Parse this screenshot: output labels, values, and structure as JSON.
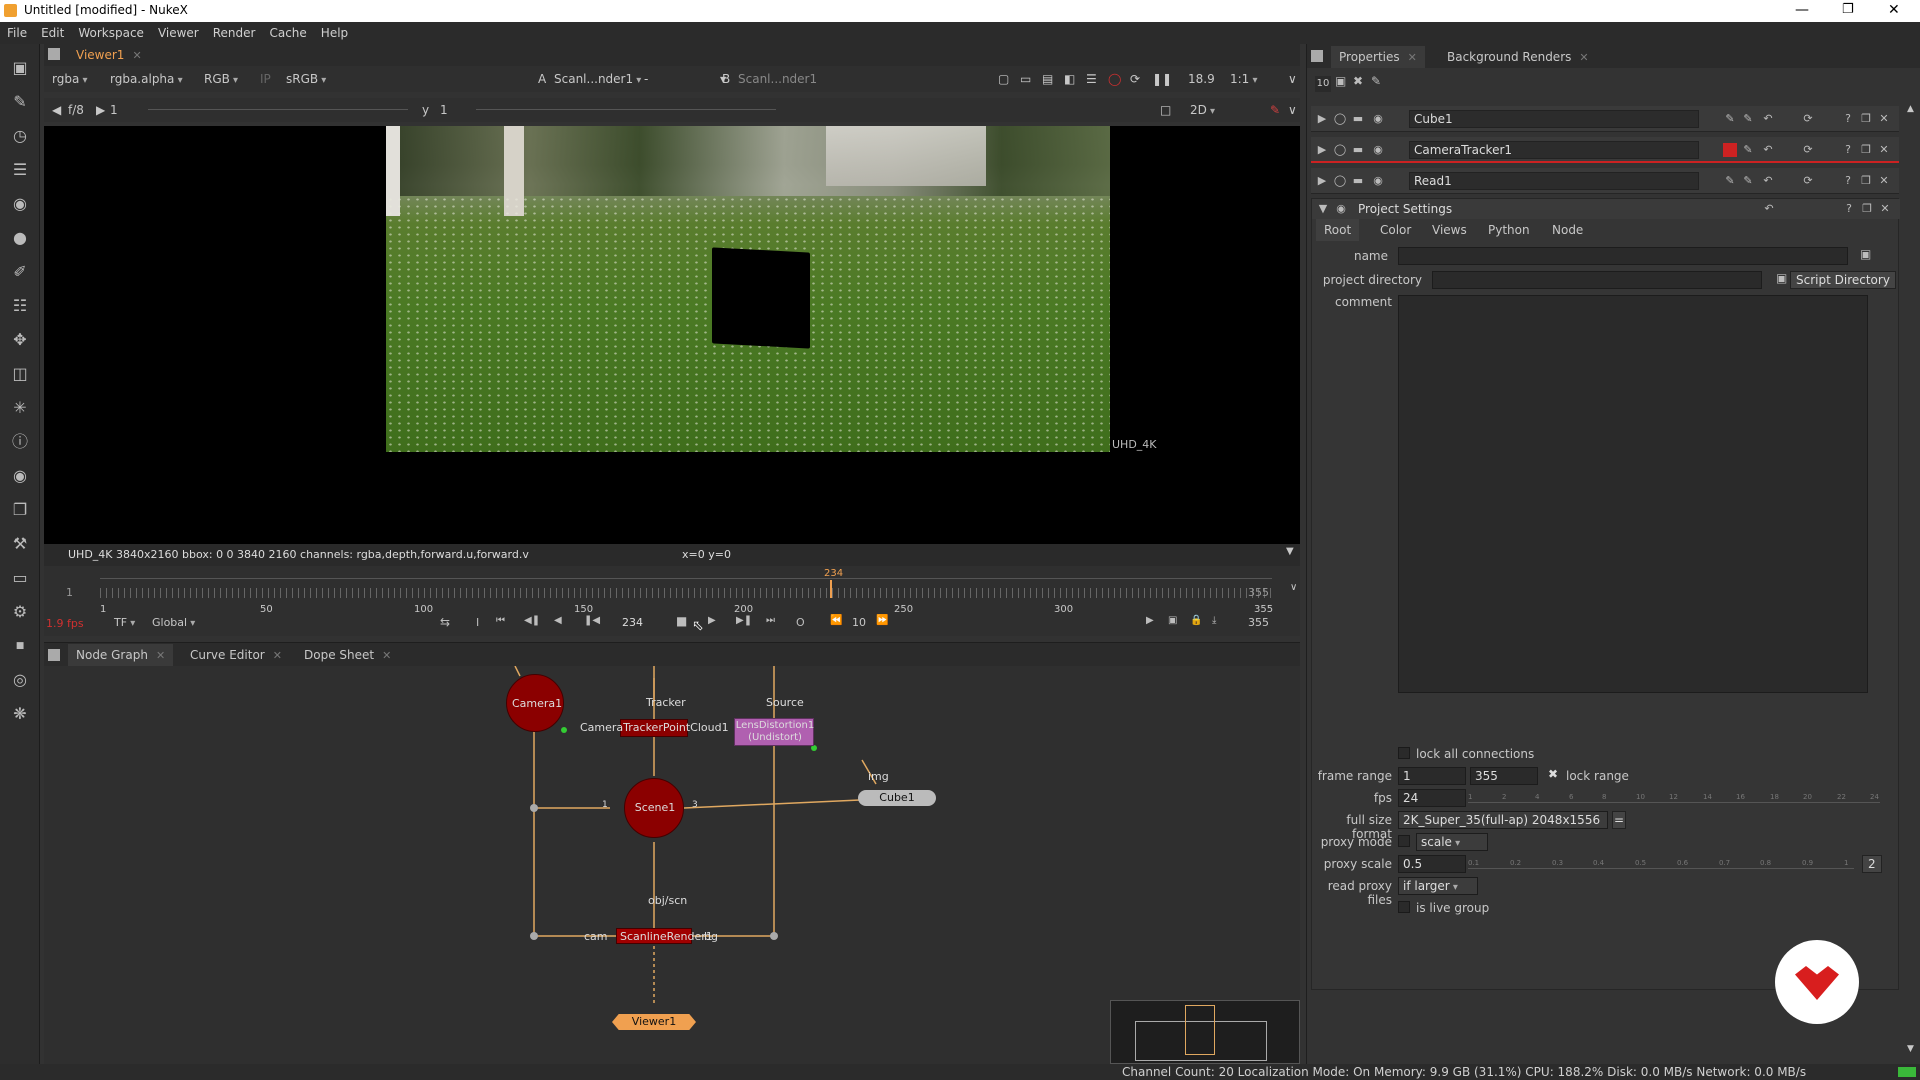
{
  "app": {
    "title": "Untitled [modified] - NukeX"
  },
  "menu": [
    "File",
    "Edit",
    "Workspace",
    "Viewer",
    "Render",
    "Cache",
    "Help"
  ],
  "viewer": {
    "tab": "Viewer1",
    "channels": "rgba",
    "alpha": "rgba.alpha",
    "colorspace_mode": "RGB",
    "ip": "IP",
    "lut": "sRGB",
    "input_a_label": "A",
    "input_a": "Scanl...nder1",
    "wipe": "-",
    "input_b_label": "B",
    "input_b": "Scanl...nder1",
    "gain": "18.9",
    "zoom": "1:1",
    "fstop": "f/8",
    "frame_start": "1",
    "y_label": "y",
    "y_value": "1",
    "view_mode": "2D",
    "format_label": "UHD_4K",
    "info": "UHD_4K 3840x2160  bbox: 0 0 3840 2160 channels: rgba,depth,forward.u,forward.v",
    "coords": "x=0 y=0"
  },
  "timeline": {
    "in": "1",
    "out": "355",
    "current": "234",
    "ticks": [
      "1",
      "50",
      "100",
      "150",
      "200",
      "250",
      "300",
      "355"
    ],
    "fps": "1.9 fps",
    "tf": "TF",
    "scope": "Global",
    "frame_field": "234",
    "step": "10",
    "end_field": "355",
    "end_frame_label": "355",
    "i_label": "I",
    "o_label": "O"
  },
  "nodegraph_tabs": [
    "Node Graph",
    "Curve Editor",
    "Dope Sheet"
  ],
  "nodes": {
    "camera": "Camera1",
    "tracker_label": "Tracker",
    "pointcloud": "CameraTrackerPointCloud1",
    "source_label": "Source",
    "lensdistortion": "LensDistortion1\n(Undistort)",
    "img_label": "img",
    "cube": "Cube1",
    "scene": "Scene1",
    "scene_in1": "1",
    "scene_in3": "3",
    "objscn_label": "obj/scn",
    "scanline": "ScanlineRender1",
    "cam_label": "cam",
    "bg_label": "bg",
    "viewer": "Viewer1"
  },
  "properties": {
    "tabs": [
      "Properties",
      "Background Renders"
    ],
    "max_panels": "10",
    "panels": [
      "Cube1",
      "CameraTracker1",
      "Read1"
    ],
    "project_title": "Project Settings",
    "project_tabs": [
      "Root",
      "Color",
      "Views",
      "Python",
      "Node"
    ],
    "name_label": "name",
    "name_value": "",
    "project_directory_label": "project directory",
    "project_directory_value": "",
    "script_directory_button": "Script Directory",
    "comment_label": "comment",
    "lock_all_connections": "lock all connections",
    "frame_range_label": "frame range",
    "frame_range_start": "1",
    "frame_range_end": "355",
    "lock_range": "lock range",
    "fps_label": "fps",
    "fps_value": "24",
    "fps_ticks": [
      "1",
      "2",
      "4",
      "6",
      "8",
      "10",
      "12",
      "14",
      "16",
      "18",
      "20",
      "22",
      "24"
    ],
    "full_size_format_label": "full size format",
    "full_size_format_value": "2K_Super_35(full-ap) 2048x1556",
    "proxy_mode_label": "proxy mode",
    "proxy_mode_value": "scale",
    "proxy_scale_label": "proxy scale",
    "proxy_scale_value": "0.5",
    "proxy_scale_ticks": [
      "0.1",
      "0.2",
      "0.3",
      "0.4",
      "0.5",
      "0.6",
      "0.7",
      "0.8",
      "0.9",
      "1"
    ],
    "proxy_scale_button": "2",
    "read_proxy_files_label": "read proxy files",
    "read_proxy_files_value": "if larger",
    "is_live_group": "is live group"
  },
  "status": "Channel Count: 20  Localization Mode: On  Memory: 9.9 GB (31.1%)  CPU: 188.2%  Disk: 0.0 MB/s  Network: 0.0 MB/s",
  "colors": {
    "node_red": "#8b0000",
    "accent_orange": "#f0a050",
    "lens_pink": "#b060b0",
    "brand_red": "#d81e1e"
  }
}
